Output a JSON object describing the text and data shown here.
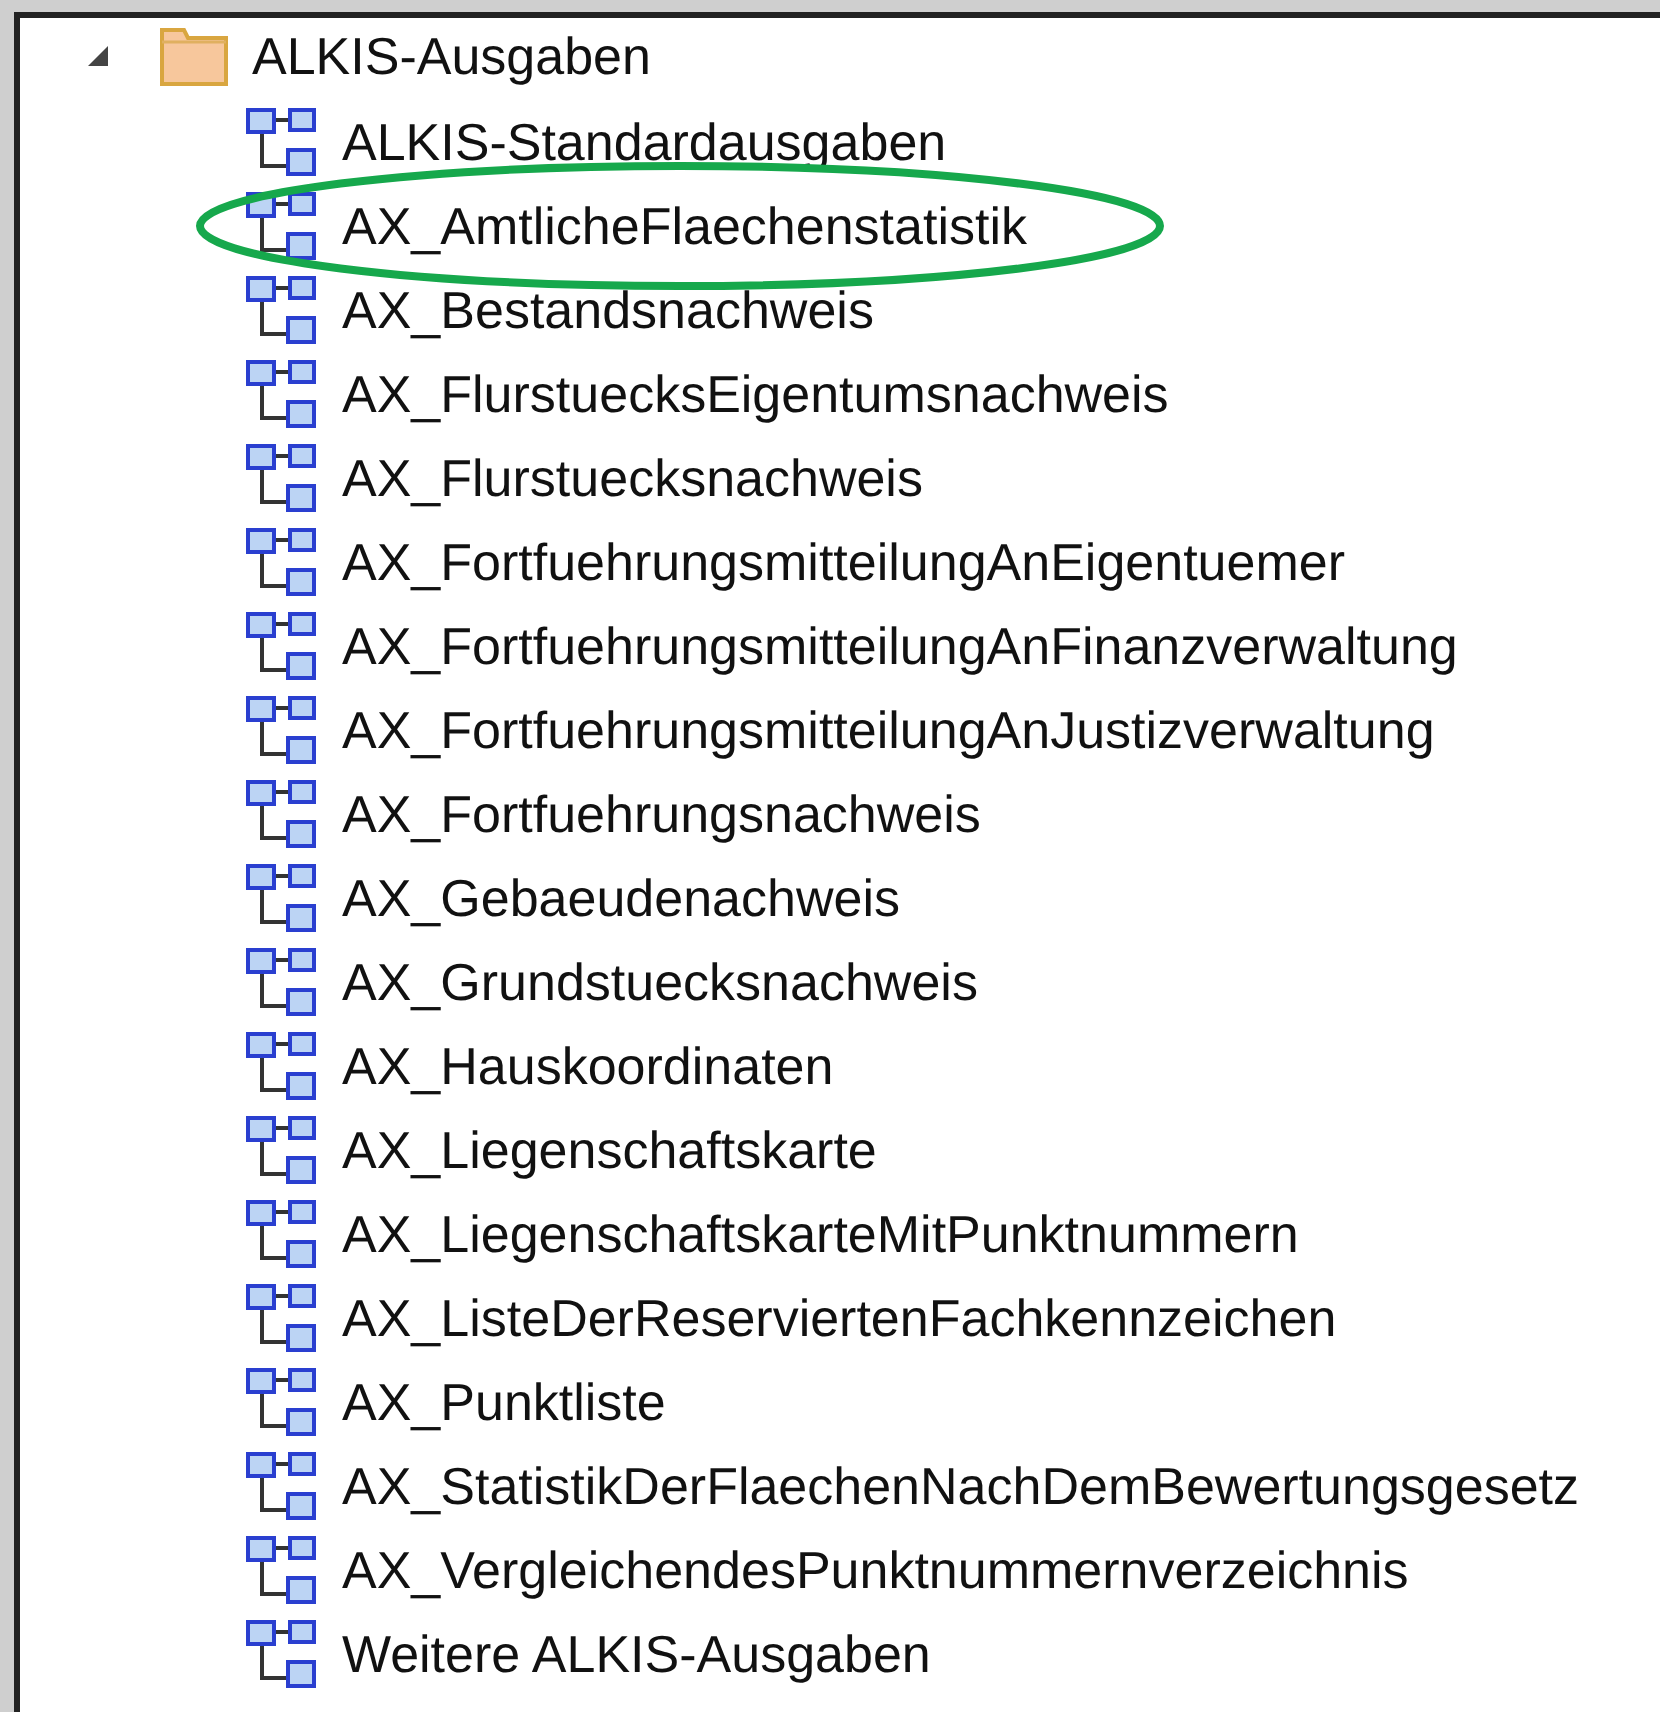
{
  "tree": {
    "label": "ALKIS-Ausgaben",
    "expanded": true,
    "children": [
      {
        "label": "ALKIS-Standardausgaben",
        "circled": false
      },
      {
        "label": "AX_AmtlicheFlaechenstatistik",
        "circled": true
      },
      {
        "label": "AX_Bestandsnachweis",
        "circled": false
      },
      {
        "label": "AX_FlurstuecksEigentumsnachweis",
        "circled": false
      },
      {
        "label": "AX_Flurstuecksnachweis",
        "circled": false
      },
      {
        "label": "AX_FortfuehrungsmitteilungAnEigentuemer",
        "circled": false
      },
      {
        "label": "AX_FortfuehrungsmitteilungAnFinanzverwaltung",
        "circled": false
      },
      {
        "label": "AX_FortfuehrungsmitteilungAnJustizverwaltung",
        "circled": false
      },
      {
        "label": "AX_Fortfuehrungsnachweis",
        "circled": false
      },
      {
        "label": "AX_Gebaeudenachweis",
        "circled": false
      },
      {
        "label": "AX_Grundstuecksnachweis",
        "circled": false
      },
      {
        "label": "AX_Hauskoordinaten",
        "circled": false
      },
      {
        "label": "AX_Liegenschaftskarte",
        "circled": false
      },
      {
        "label": "AX_LiegenschaftskarteMitPunktnummern",
        "circled": false
      },
      {
        "label": "AX_ListeDerReserviertenFachkennzeichen",
        "circled": false
      },
      {
        "label": "AX_Punktliste",
        "circled": false
      },
      {
        "label": "AX_StatistikDerFlaechenNachDemBewertungsgesetz",
        "circled": false
      },
      {
        "label": "AX_VergleichendesPunktnummernverzeichnis",
        "circled": false
      },
      {
        "label": "Weitere ALKIS-Ausgaben",
        "circled": false
      }
    ]
  }
}
